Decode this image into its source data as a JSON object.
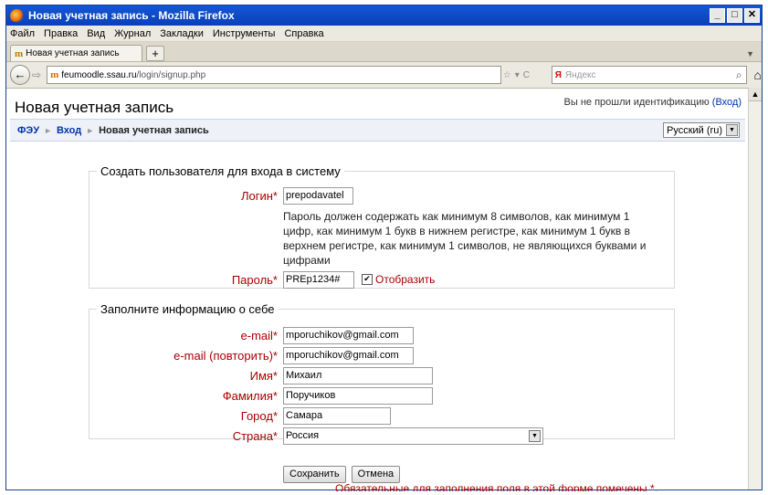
{
  "window": {
    "title": "Новая учетная запись - Mozilla Firefox"
  },
  "menu": [
    "Файл",
    "Правка",
    "Вид",
    "Журнал",
    "Закладки",
    "Инструменты",
    "Справка"
  ],
  "tab": {
    "label": "Новая учетная запись",
    "new_tab": "+"
  },
  "nav": {
    "url_host": "feumoodle.ssau.ru",
    "url_path": "/login/signup.php",
    "search_placeholder": "Яндекс",
    "search_brand": "Я"
  },
  "header": {
    "page_title": "Новая учетная запись",
    "login_text": "Вы не прошли идентификацию",
    "login_link": "(Вход)"
  },
  "breadcrumb": {
    "root": "ФЭУ",
    "login": "Вход",
    "current": "Новая учетная запись",
    "sep": "►"
  },
  "language": {
    "selected": "Русский (ru)"
  },
  "section1": {
    "legend": "Создать пользователя для входа в систему",
    "login_label": "Логин*",
    "login_value": "prepodavatel",
    "password_note": "Пароль должен содержать как минимум 8 символов, как минимум 1 цифр, как минимум 1 букв в нижнем регистре, как минимум 1 букв в верхнем регистре, как минимум 1 символов, не являющихся буквами и цифрами",
    "password_label": "Пароль*",
    "password_value": "PREp1234#",
    "show_label": "Отобразить",
    "show_checked": "✔"
  },
  "section2": {
    "legend": "Заполните информацию о себе",
    "fields": [
      {
        "label": "e-mail*",
        "value": "mporuchikov@gmail.com"
      },
      {
        "label": "e-mail (повторить)*",
        "value": "mporuchikov@gmail.com"
      },
      {
        "label": "Имя*",
        "value": "Михаил"
      },
      {
        "label": "Фамилия*",
        "value": "Поручиков"
      },
      {
        "label": "Город*",
        "value": "Самара"
      },
      {
        "label": "Страна*",
        "value": "Россия"
      }
    ]
  },
  "actions": {
    "save": "Сохранить",
    "cancel": "Отмена"
  },
  "required_note": "Обязательные для заполнения поля в этой форме помечены *."
}
